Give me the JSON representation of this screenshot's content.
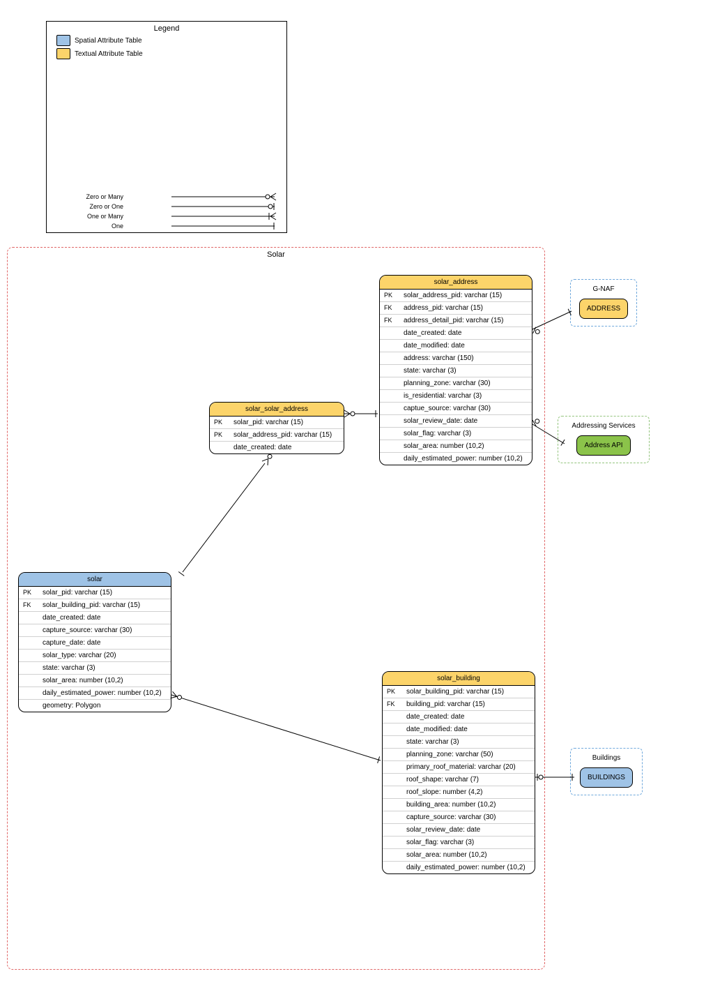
{
  "legend": {
    "title": "Legend",
    "spatial_label": "Spatial Attribute Table",
    "textual_label": "Textual Attribute Table",
    "line_labels": {
      "zero_many": "Zero or Many",
      "zero_one": "Zero or One",
      "one_many": "One or Many",
      "one": "One"
    }
  },
  "group": {
    "title": "Solar"
  },
  "tables": {
    "solar_address": {
      "title": "solar_address",
      "rows": [
        {
          "k": "PK",
          "v": "solar_address_pid: varchar (15)"
        },
        {
          "k": "FK",
          "v": "address_pid: varchar (15)"
        },
        {
          "k": "FK",
          "v": "address_detail_pid: varchar (15)"
        },
        {
          "k": "",
          "v": "date_created: date"
        },
        {
          "k": "",
          "v": "date_modified: date"
        },
        {
          "k": "",
          "v": "address: varchar (150)"
        },
        {
          "k": "",
          "v": "state: varchar (3)"
        },
        {
          "k": "",
          "v": "planning_zone: varchar (30)"
        },
        {
          "k": "",
          "v": "is_residential: varchar (3)"
        },
        {
          "k": "",
          "v": "captue_source: varchar (30)"
        },
        {
          "k": "",
          "v": "solar_review_date: date"
        },
        {
          "k": "",
          "v": "solar_flag: varchar (3)"
        },
        {
          "k": "",
          "v": "solar_area: number (10,2)"
        },
        {
          "k": "",
          "v": "daily_estimated_power: number (10,2)"
        }
      ]
    },
    "solar_solar_address": {
      "title": "solar_solar_address",
      "rows": [
        {
          "k": "PK",
          "v": "solar_pid: varchar (15)"
        },
        {
          "k": "PK",
          "v": "solar_address_pid: varchar (15)"
        },
        {
          "k": "",
          "v": "date_created: date"
        }
      ]
    },
    "solar": {
      "title": "solar",
      "rows": [
        {
          "k": "PK",
          "v": "solar_pid: varchar (15)"
        },
        {
          "k": "FK",
          "v": "solar_building_pid: varchar (15)"
        },
        {
          "k": "",
          "v": "date_created: date"
        },
        {
          "k": "",
          "v": "capture_source: varchar (30)"
        },
        {
          "k": "",
          "v": "capture_date: date"
        },
        {
          "k": "",
          "v": "solar_type: varchar (20)"
        },
        {
          "k": "",
          "v": "state: varchar (3)"
        },
        {
          "k": "",
          "v": "solar_area: number (10,2)"
        },
        {
          "k": "",
          "v": "daily_estimated_power: number (10,2)"
        },
        {
          "k": "",
          "v": "geometry: Polygon"
        }
      ]
    },
    "solar_building": {
      "title": "solar_building",
      "rows": [
        {
          "k": "PK",
          "v": "solar_building_pid: varchar (15)"
        },
        {
          "k": "FK",
          "v": "building_pid: varchar (15)"
        },
        {
          "k": "",
          "v": "date_created: date"
        },
        {
          "k": "",
          "v": "date_modified: date"
        },
        {
          "k": "",
          "v": "state: varchar (3)"
        },
        {
          "k": "",
          "v": "planning_zone: varchar (50)"
        },
        {
          "k": "",
          "v": "primary_roof_material: varchar (20)"
        },
        {
          "k": "",
          "v": "roof_shape: varchar (7)"
        },
        {
          "k": "",
          "v": "roof_slope: number (4,2)"
        },
        {
          "k": "",
          "v": "building_area: number (10,2)"
        },
        {
          "k": "",
          "v": "capture_source: varchar (30)"
        },
        {
          "k": "",
          "v": "solar_review_date: date"
        },
        {
          "k": "",
          "v": "solar_flag: varchar (3)"
        },
        {
          "k": "",
          "v": "solar_area: number (10,2)"
        },
        {
          "k": "",
          "v": "daily_estimated_power: number (10,2)"
        }
      ]
    }
  },
  "externals": {
    "gnaf": {
      "title": "G-NAF",
      "chip": "ADDRESS"
    },
    "addrsvc": {
      "title": "Addressing Services",
      "chip": "Address API"
    },
    "buildings": {
      "title": "Buildings",
      "chip": "BUILDINGS"
    }
  }
}
